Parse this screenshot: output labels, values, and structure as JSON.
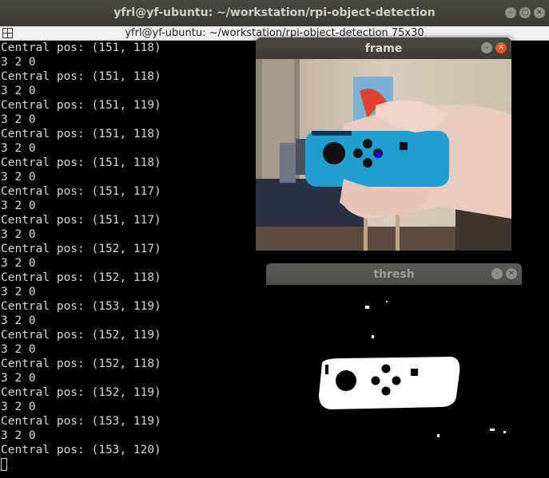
{
  "outer_window": {
    "title": "yfrl@yf-ubuntu: ~/workstation/rpi-object-detection"
  },
  "terminal": {
    "title": "yfrl@yf-ubuntu: ~/workstation/rpi-object-detection 75x30",
    "lines": [
      "Central pos: (151, 118)",
      "3 2 0",
      "Central pos: (151, 118)",
      "3 2 0",
      "Central pos: (151, 119)",
      "3 2 0",
      "Central pos: (151, 118)",
      "3 2 0",
      "Central pos: (151, 118)",
      "3 2 0",
      "Central pos: (151, 117)",
      "3 2 0",
      "Central pos: (151, 117)",
      "3 2 0",
      "Central pos: (152, 117)",
      "3 2 0",
      "Central pos: (152, 118)",
      "3 2 0",
      "Central pos: (153, 119)",
      "3 2 0",
      "Central pos: (152, 119)",
      "3 2 0",
      "Central pos: (152, 118)",
      "3 2 0",
      "Central pos: (152, 119)",
      "3 2 0",
      "Central pos: (153, 119)",
      "3 2 0",
      "Central pos: (153, 120)"
    ]
  },
  "frame_window": {
    "title": "frame"
  },
  "thresh_window": {
    "title": "thresh"
  },
  "colors": {
    "ubuntu_close": "#e95420",
    "terminal_bg": "#000000",
    "terminal_fg": "#d8d8d8",
    "controller_blue": "#1e9fd0",
    "detected_point": "#0000ff"
  },
  "icons": {
    "minimize": "minimize-icon",
    "maximize": "maximize-icon",
    "close": "close-icon",
    "menu": "terminal-menu-icon"
  }
}
